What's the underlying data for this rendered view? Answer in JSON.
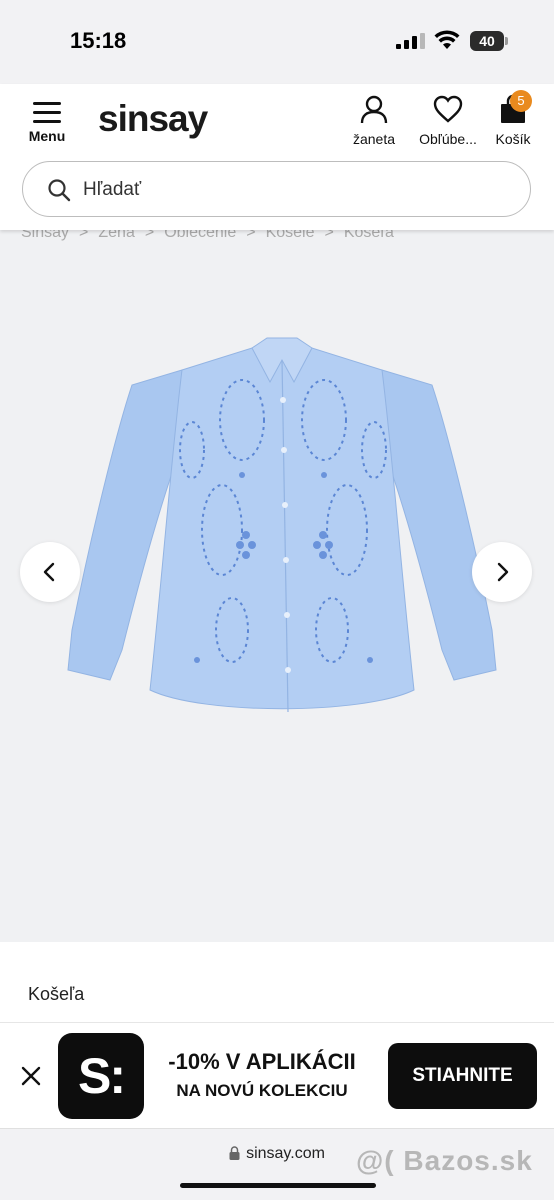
{
  "status_bar": {
    "time": "15:18",
    "battery": "40"
  },
  "header": {
    "menu_label": "Menu",
    "logo": "sinsay",
    "user_label": "žaneta",
    "favorites_label": "Obľúbe...",
    "cart_label": "Košík",
    "cart_count": "5"
  },
  "search": {
    "placeholder": "Hľadať"
  },
  "breadcrumb": [
    "Sinsay",
    "Žena",
    "Oblečenie",
    "Košele",
    "Košeľa"
  ],
  "product": {
    "name": "Košeľa"
  },
  "app_banner": {
    "title": "-10% V APLIKÁCII",
    "subtitle": "NA NOVÚ KOLEKCIU",
    "cta": "STIAHNITE",
    "icon_text": "S:"
  },
  "browser": {
    "url": "sinsay.com"
  },
  "watermark": "@( Bazos.sk",
  "colors": {
    "accent_badge": "#e98a1e",
    "banner_button": "#0d0d0d",
    "shirt": "#a9c7f0"
  }
}
